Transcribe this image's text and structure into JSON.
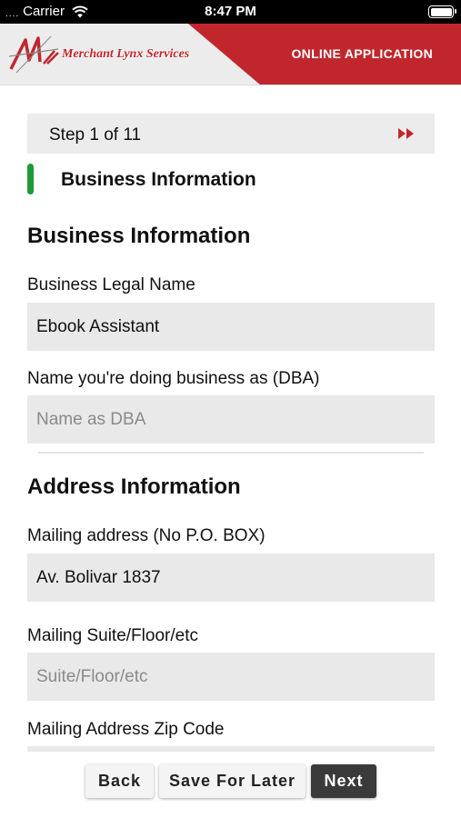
{
  "status_bar": {
    "carrier": "Carrier",
    "time": "8:47 PM"
  },
  "header": {
    "logo_text": "Merchant Lynx Services",
    "title": "ONLINE APPLICATION",
    "accent_color": "#c0272d"
  },
  "step": {
    "label": "Step 1 of 11",
    "next_icon": "fast-forward-icon"
  },
  "section": {
    "label": "Business Information",
    "indicator_color": "#1e9a3a"
  },
  "business_info": {
    "heading": "Business Information",
    "legal_name_label": "Business Legal Name",
    "legal_name_value": "Ebook Assistant",
    "dba_label": "Name you're doing business as (DBA)",
    "dba_placeholder": "Name as DBA"
  },
  "address_info": {
    "heading": "Address Information",
    "mailing_address_label": "Mailing address (No P.O. BOX)",
    "mailing_address_value": "Av. Bolivar 1837",
    "suite_label": "Mailing Suite/Floor/etc",
    "suite_placeholder": "Suite/Floor/etc",
    "zip_label": "Mailing Address Zip Code"
  },
  "actions": {
    "back": "Back",
    "save_for_later": "Save For Later",
    "next": "Next"
  }
}
